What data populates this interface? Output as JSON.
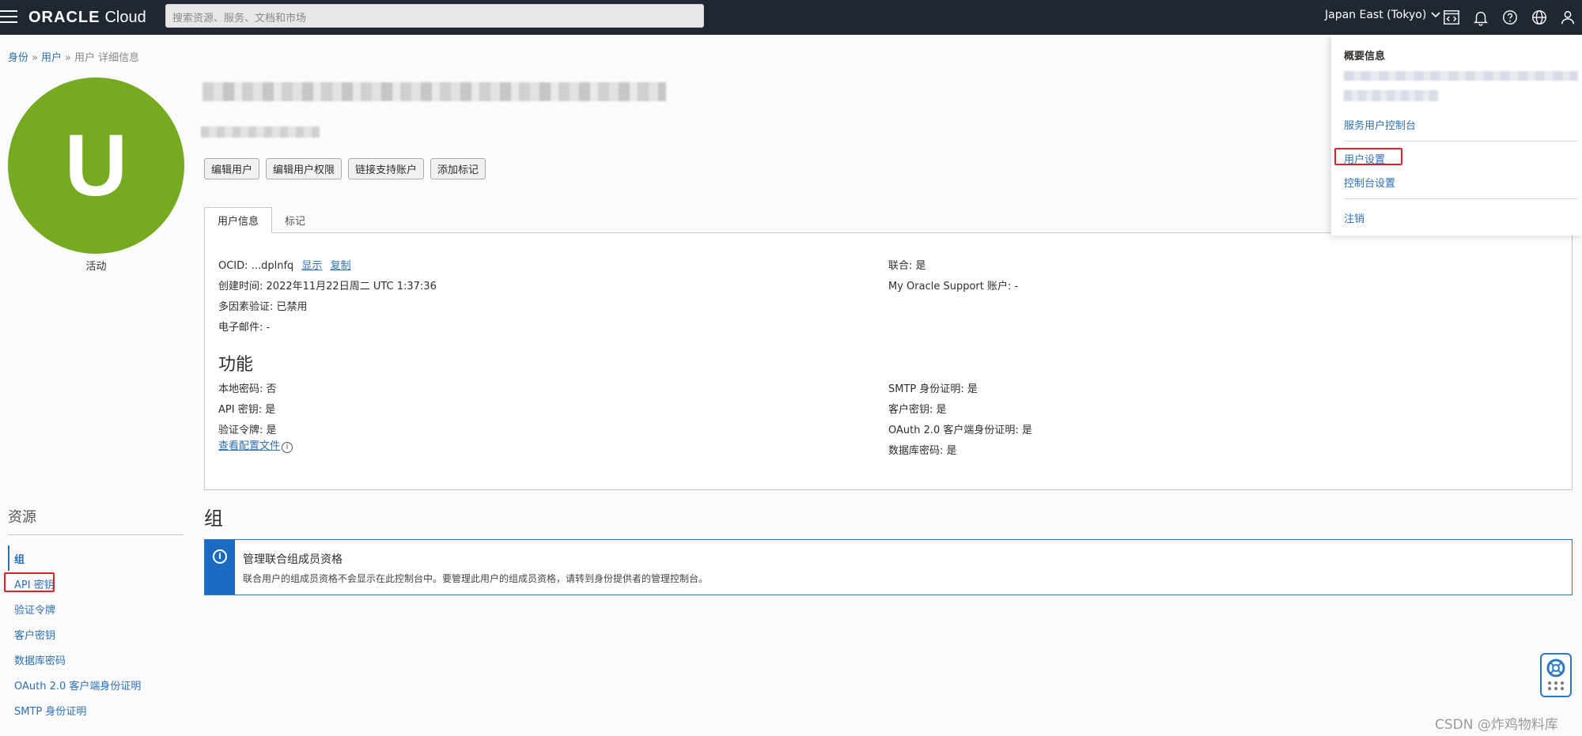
{
  "header": {
    "brand": "ORACLE",
    "product": "Cloud",
    "search_placeholder": "搜索资源、服务、文档和市场",
    "region": "Japan East (Tokyo)"
  },
  "breadcrumb": {
    "items": [
      "身份",
      "用户",
      "用户 详细信息"
    ]
  },
  "avatar": {
    "initial": "U",
    "status": "活动"
  },
  "actions": [
    "编辑用户",
    "编辑用户权限",
    "链接支持账户",
    "添加标记"
  ],
  "tabs": [
    "用户信息",
    "标记"
  ],
  "user_info": {
    "ocid_label": "OCID:",
    "ocid_value": "...dplnfq",
    "ocid_show": "显示",
    "ocid_copy": "复制",
    "created_label": "创建时间:",
    "created_value": "2022年11月22日周二 UTC 1:37:36",
    "mfa_label": "多因素验证:",
    "mfa_value": "已禁用",
    "email_label": "电子邮件:",
    "email_value": "-",
    "federated_label": "联合:",
    "federated_value": "是",
    "mos_label": "My Oracle Support 账户:",
    "mos_value": "-"
  },
  "capabilities": {
    "title": "功能",
    "local_password_label": "本地密码:",
    "local_password_value": "否",
    "api_keys_label": "API 密钥:",
    "api_keys_value": "是",
    "auth_tokens_label": "验证令牌:",
    "auth_tokens_value": "是",
    "view_profile": "查看配置文件",
    "smtp_label": "SMTP 身份证明:",
    "smtp_value": "是",
    "customer_keys_label": "客户密钥:",
    "customer_keys_value": "是",
    "oauth_label": "OAuth 2.0 客户端身份证明:",
    "oauth_value": "是",
    "db_password_label": "数据库密码:",
    "db_password_value": "是"
  },
  "resources": {
    "title": "资源",
    "items": [
      "组",
      "API 密钥",
      "验证令牌",
      "客户密钥",
      "数据库密码",
      "OAuth 2.0 客户端身份证明",
      "SMTP 身份证明"
    ]
  },
  "groups": {
    "title": "组",
    "notice_title": "管理联合组成员资格",
    "notice_body": "联合用户的组成员资格不会显示在此控制台中。要管理此用户的组成员资格，请转到身份提供者的管理控制台。"
  },
  "profile_menu": {
    "title": "概要信息",
    "service_console": "服务用户控制台",
    "user_settings": "用户设置",
    "console_settings": "控制台设置",
    "sign_out": "注销"
  },
  "watermark": "CSDN @炸鸡物料库",
  "colors": {
    "header_bg": "#1f2731",
    "avatar": "#75aa21",
    "link": "#2c6fb4",
    "highlight": "#e0202a",
    "notice_bar": "#1c6bc3"
  }
}
